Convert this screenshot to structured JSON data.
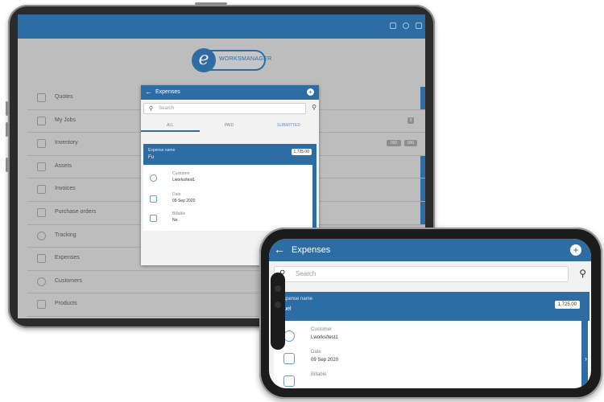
{
  "tablet": {
    "logo": {
      "letter": "e",
      "text": "WORKSMANAGER"
    },
    "topbar_icons": [
      "window-icon",
      "settings-icon",
      "logout-icon"
    ],
    "menu": [
      {
        "label": "Quotes",
        "icon": "quote-icon",
        "badges": []
      },
      {
        "label": "My Jobs",
        "icon": "briefcase-icon",
        "badges": [
          "0"
        ]
      },
      {
        "label": "Inventory",
        "icon": "cart-icon",
        "badges": [
          "000",
          "000"
        ]
      },
      {
        "label": "Assets",
        "icon": "cube-icon",
        "badges": []
      },
      {
        "label": "Invoices",
        "icon": "invoice-icon",
        "badges": []
      },
      {
        "label": "Purchase orders",
        "icon": "document-icon",
        "badges": []
      },
      {
        "label": "Tracking",
        "icon": "clock-icon",
        "badges": []
      },
      {
        "label": "Expenses",
        "icon": "expense-icon",
        "badges": []
      },
      {
        "label": "Customers",
        "icon": "people-icon",
        "badges": []
      },
      {
        "label": "Products",
        "icon": "tag-icon",
        "badges": []
      }
    ],
    "dialog": {
      "title": "Expenses",
      "search_placeholder": "Search",
      "tabs": [
        "ALL",
        "PAID",
        "SUBMITTED"
      ],
      "active_tab": 0,
      "card": {
        "header_label": "Expense name",
        "header_value": "Fu",
        "amount": "1,725.00",
        "fields": [
          {
            "label": "Customer",
            "value": "Lworks/test1",
            "icon": "person-icon"
          },
          {
            "label": "Date",
            "value": "09 Sep 2020",
            "icon": "calendar-icon"
          },
          {
            "label": "Billable",
            "value": "No",
            "icon": "billable-icon"
          }
        ]
      }
    }
  },
  "phone": {
    "title": "Expenses",
    "search_placeholder": "Search",
    "card": {
      "header_label": "Expense name",
      "header_value": "Fuel",
      "amount": "1,725.00",
      "fields": [
        {
          "label": "Customer",
          "value": "Lworks/test1",
          "icon": "person-icon"
        },
        {
          "label": "Date",
          "value": "09 Sep 2020",
          "icon": "calendar-icon"
        },
        {
          "label": "Billable",
          "value": "",
          "icon": "billable-icon"
        }
      ]
    }
  },
  "colors": {
    "brand": "#2e6da4",
    "overlay": "#bdbdbd",
    "card_body": "#ffffff"
  }
}
